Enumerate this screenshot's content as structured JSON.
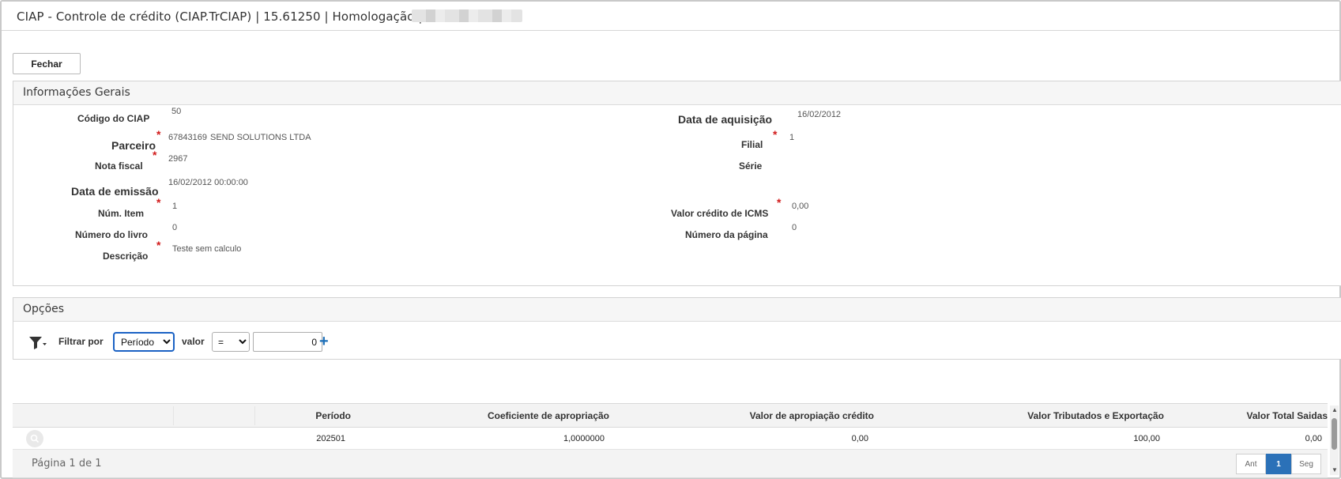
{
  "window": {
    "title": "CIAP - Controle de crédito (CIAP.TrCIAP) | 15.61250 | Homologação | "
  },
  "toolbar": {
    "close_label": "Fechar"
  },
  "info_panel": {
    "title": "Informações Gerais",
    "required_mark": "*",
    "fields": {
      "codigo_label": "Código do CIAP",
      "codigo_value": "50",
      "parceiro_label": "Parceiro",
      "parceiro_code": "67843169",
      "parceiro_name": "SEND SOLUTIONS LTDA",
      "nota_label": "Nota fiscal",
      "nota_value": "2967",
      "emissao_label": "Data de emissão",
      "emissao_value": "16/02/2012 00:00:00",
      "item_label": "Núm. Item",
      "item_value": "1",
      "livro_label": "Número do livro",
      "livro_value": "0",
      "descricao_label": "Descrição",
      "descricao_value": "Teste sem calculo",
      "aquisicao_label": "Data de aquisição",
      "aquisicao_value": "16/02/2012",
      "filial_label": "Filial",
      "filial_value": "1",
      "serie_label": "Série",
      "icms_label": "Valor crédito de ICMS",
      "icms_value": "0,00",
      "pagina_label": "Número da página",
      "pagina_value": "0"
    }
  },
  "options_panel": {
    "title": "Opções",
    "filter_label": "Filtrar por",
    "field_options": [
      "Período"
    ],
    "value_label": "valor",
    "operator_options": [
      "="
    ],
    "value_input": "0",
    "add_symbol": "+"
  },
  "grid": {
    "columns": [
      "Período",
      "Coeficiente de apropriação",
      "Valor de apropiação crédito",
      "Valor Tributados e Exportação",
      "Valor Total Saidas"
    ],
    "rows": [
      [
        "202501",
        "1,0000000",
        "0,00",
        "100,00",
        "0,00"
      ]
    ],
    "page_info": "Página 1 de 1",
    "pager": {
      "prev": "Ant",
      "current": "1",
      "next": "Seg"
    }
  },
  "colors": {
    "accent": "#2b71b8",
    "required": "#d11a1a",
    "add_icon": "#1d6fb8"
  },
  "icons": [
    "filter-icon",
    "chevron-down-icon",
    "plus-icon",
    "search-icon",
    "scroll-up-icon",
    "scroll-down-icon"
  ]
}
